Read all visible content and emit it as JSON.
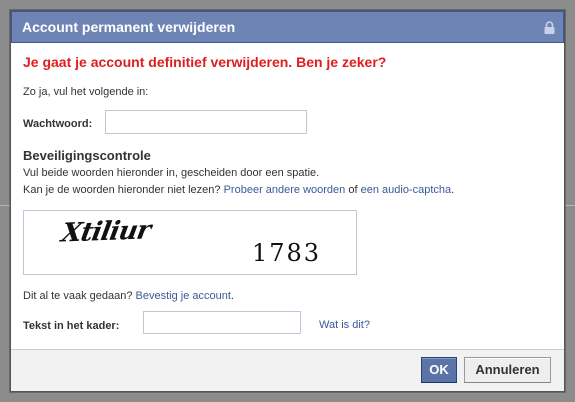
{
  "dialog": {
    "title": "Account permanent verwijderen",
    "heading": "Je gaat je account definitief verwijderen. Ben je zeker?",
    "intro": "Zo ja, vul het volgende in:",
    "password_label": "Wachtwoord:",
    "password_value": "",
    "security": {
      "heading": "Beveiligingscontrole",
      "line1": "Vul beide woorden hieronder in, gescheiden door een spatie.",
      "line2_prefix": "Kan je de woorden hieronder niet lezen?",
      "link_other_words": "Probeer andere woorden",
      "line2_middle": "of",
      "link_audio": "een audio-captcha",
      "line2_suffix": ".",
      "captcha_word1": "Xtiliur",
      "captcha_word2": "1783"
    },
    "too_often_prefix": "Dit al te vaak gedaan?",
    "link_confirm": "Bevestig je account",
    "too_often_suffix": ".",
    "text_label": "Tekst in het kader:",
    "text_value": "",
    "link_what": "Wat is dit?"
  },
  "buttons": {
    "ok": "OK",
    "cancel": "Annuleren"
  },
  "colors": {
    "titlebar": "#6d84b4",
    "heading_red": "#dd1f1f",
    "link_blue": "#3b5998"
  }
}
